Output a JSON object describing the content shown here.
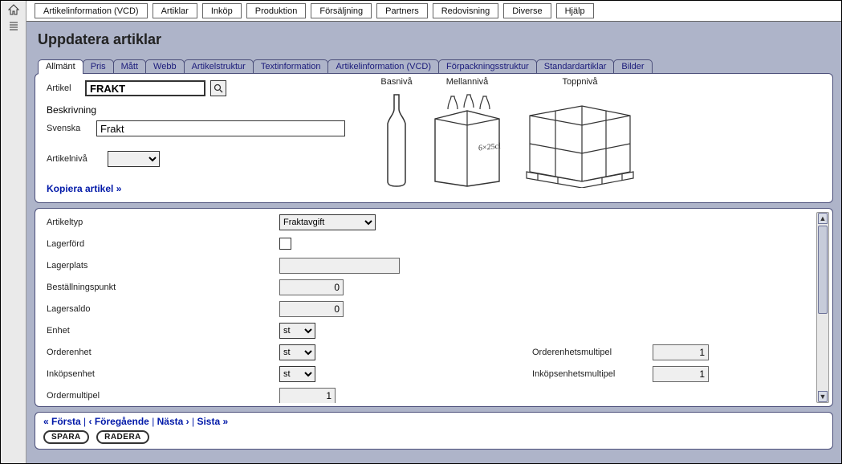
{
  "menu": [
    "Artikelinformation (VCD)",
    "Artiklar",
    "Inköp",
    "Produktion",
    "Försäljning",
    "Partners",
    "Redovisning",
    "Diverse",
    "Hjälp"
  ],
  "page_title": "Uppdatera artiklar",
  "tabs": [
    "Allmänt",
    "Pris",
    "Mått",
    "Webb",
    "Artikelstruktur",
    "Textinformation",
    "Artikelinformation (VCD)",
    "Förpackningsstruktur",
    "Standardartiklar",
    "Bilder"
  ],
  "active_tab": 0,
  "upper": {
    "artikel_label": "Artikel",
    "artikel_value": "FRAKT",
    "beskrivning_label": "Beskrivning",
    "svenska_label": "Svenska",
    "svenska_value": "Frakt",
    "niva_label": "Artikelnivå",
    "niva_value": "",
    "copy_link": "Kopiera artikel »",
    "levels": {
      "bas": "Basnivå",
      "mellan": "Mellannivå",
      "topp": "Toppnivå"
    }
  },
  "fields": {
    "artikeltyp": {
      "label": "Artikeltyp",
      "value": "Fraktavgift"
    },
    "lagerford": {
      "label": "Lagerförd",
      "checked": false
    },
    "lagerplats": {
      "label": "Lagerplats",
      "value": ""
    },
    "bestallning": {
      "label": "Beställningspunkt",
      "value": "0"
    },
    "lagersaldo": {
      "label": "Lagersaldo",
      "value": "0"
    },
    "enhet": {
      "label": "Enhet",
      "value": "st"
    },
    "orderenhet": {
      "label": "Orderenhet",
      "value": "st"
    },
    "orderenhet_mult": {
      "label": "Orderenhetsmultipel",
      "value": "1"
    },
    "inkop": {
      "label": "Inköpsenhet",
      "value": "st"
    },
    "inkop_mult": {
      "label": "Inköpsenhetsmultipel",
      "value": "1"
    },
    "ordermultipel": {
      "label": "Ordermultipel",
      "value": "1"
    }
  },
  "footer": {
    "first": "« Första",
    "prev": "‹ Föregående",
    "next": "Nästa ›",
    "last": "Sista »",
    "save": "SPARA",
    "delete": "RADERA"
  }
}
